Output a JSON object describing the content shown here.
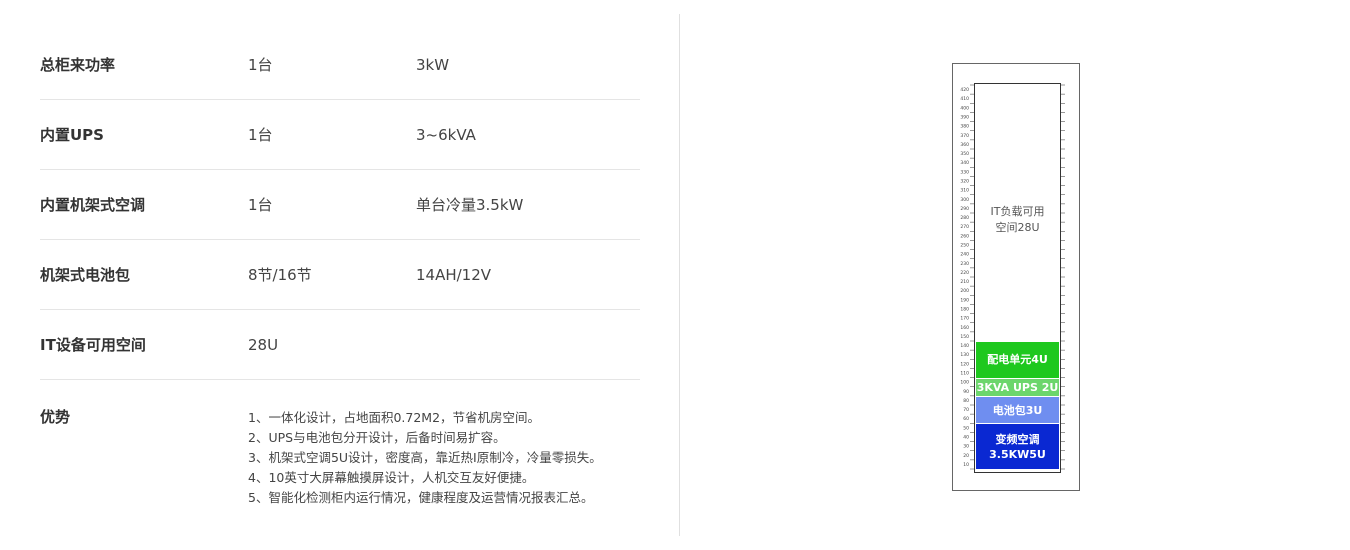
{
  "specs": [
    {
      "name": "总柜来功率",
      "qty": "1台",
      "value": "3kW"
    },
    {
      "name": "内置UPS",
      "qty": "1台",
      "value": "3~6kVA"
    },
    {
      "name": "内置机架式空调",
      "qty": "1台",
      "value": "单台冷量3.5kW"
    },
    {
      "name": "机架式电池包",
      "qty": "8节/16节",
      "value": "14AH/12V"
    },
    {
      "name": "IT设备可用空间",
      "qty": "28U",
      "value": ""
    }
  ],
  "advantages": {
    "title": "优势",
    "items": [
      "1、一体化设计，占地面积0.72M2，节省机房空间。",
      "2、UPS与电池包分开设计，后备时间易扩容。",
      "3、机架式空调5U设计，密度高，靠近热I原制冷，冷量零损失。",
      "4、10英寸大屏幕触摸屏设计，人机交互友好便捷。",
      "5、智能化检测柜内运行情况，健康程度及运营情况报表汇总。"
    ]
  },
  "cabinet": {
    "free_space": {
      "line1": "IT负载可用",
      "line2": "空间28U"
    },
    "modules": [
      {
        "label": "配电单元4U",
        "units": 4,
        "color": "#1ec81e"
      },
      {
        "label": "3KVA UPS 2U",
        "units": 2,
        "color": "#6cd66c"
      },
      {
        "label": "电池包3U",
        "units": 3,
        "color": "#6f8ef0"
      },
      {
        "label": "变频空调",
        "label2": "3.5KW5U",
        "units": 5,
        "color": "#0a28d2"
      }
    ],
    "total_units": 42,
    "scale_labels": [
      "420",
      "410",
      "400",
      "390",
      "380",
      "370",
      "360",
      "350",
      "340",
      "330",
      "320",
      "310",
      "300",
      "290",
      "280",
      "270",
      "260",
      "250",
      "240",
      "230",
      "220",
      "210",
      "200",
      "190",
      "180",
      "170",
      "160",
      "150",
      "140",
      "130",
      "120",
      "110",
      "100",
      "90",
      "80",
      "70",
      "60",
      "50",
      "40",
      "30",
      "20",
      "10"
    ]
  }
}
